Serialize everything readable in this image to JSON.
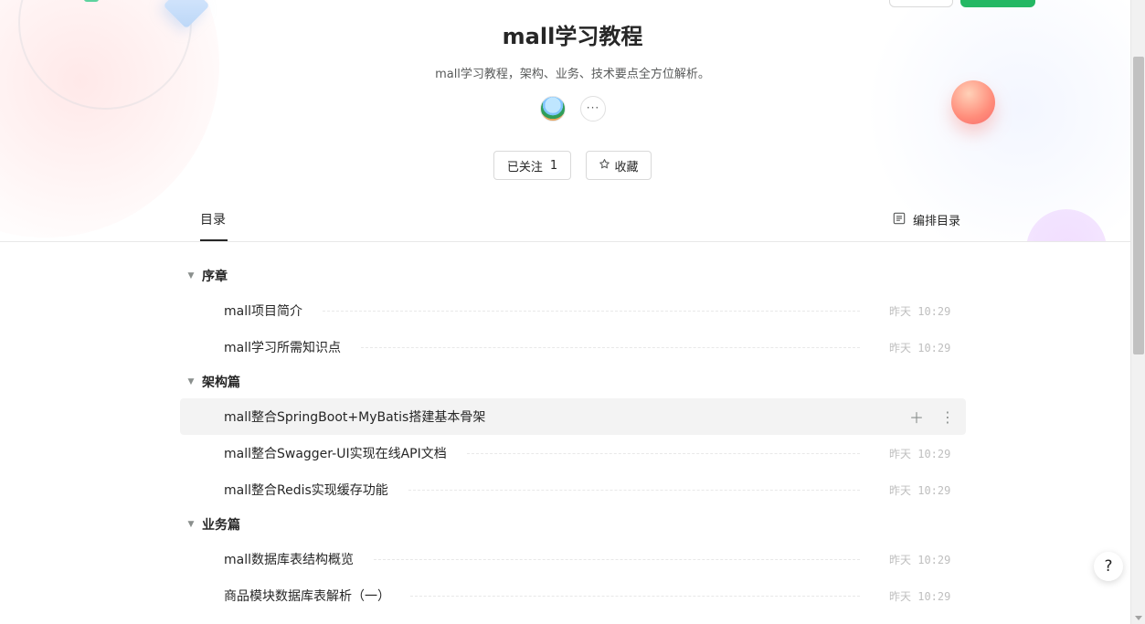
{
  "book": {
    "title": "mall学习教程",
    "description": "mall学习教程，架构、业务、技术要点全方位解析。",
    "more_label": "···",
    "follow_label": "已关注",
    "follow_count": "1",
    "favorite_label": "收藏"
  },
  "tabs": {
    "toc_label": "目录",
    "edit_toc_label": "编排目录"
  },
  "toc": {
    "groups": [
      {
        "title": "序章",
        "items": [
          {
            "label": "mall项目简介",
            "time": "昨天 10:29"
          },
          {
            "label": "mall学习所需知识点",
            "time": "昨天 10:29"
          }
        ]
      },
      {
        "title": "架构篇",
        "items": [
          {
            "label": "mall整合SpringBoot+MyBatis搭建基本骨架",
            "time": ""
          },
          {
            "label": "mall整合Swagger-UI实现在线API文档",
            "time": "昨天 10:29"
          },
          {
            "label": "mall整合Redis实现缓存功能",
            "time": "昨天 10:29"
          }
        ]
      },
      {
        "title": "业务篇",
        "items": [
          {
            "label": "mall数据库表结构概览",
            "time": "昨天 10:29"
          },
          {
            "label": "商品模块数据库表解析（一）",
            "time": "昨天 10:29"
          }
        ]
      }
    ]
  },
  "help_label": "?",
  "colors": {
    "primary_green": "#25b864",
    "text": "#262626",
    "muted": "#bfbfbf"
  }
}
